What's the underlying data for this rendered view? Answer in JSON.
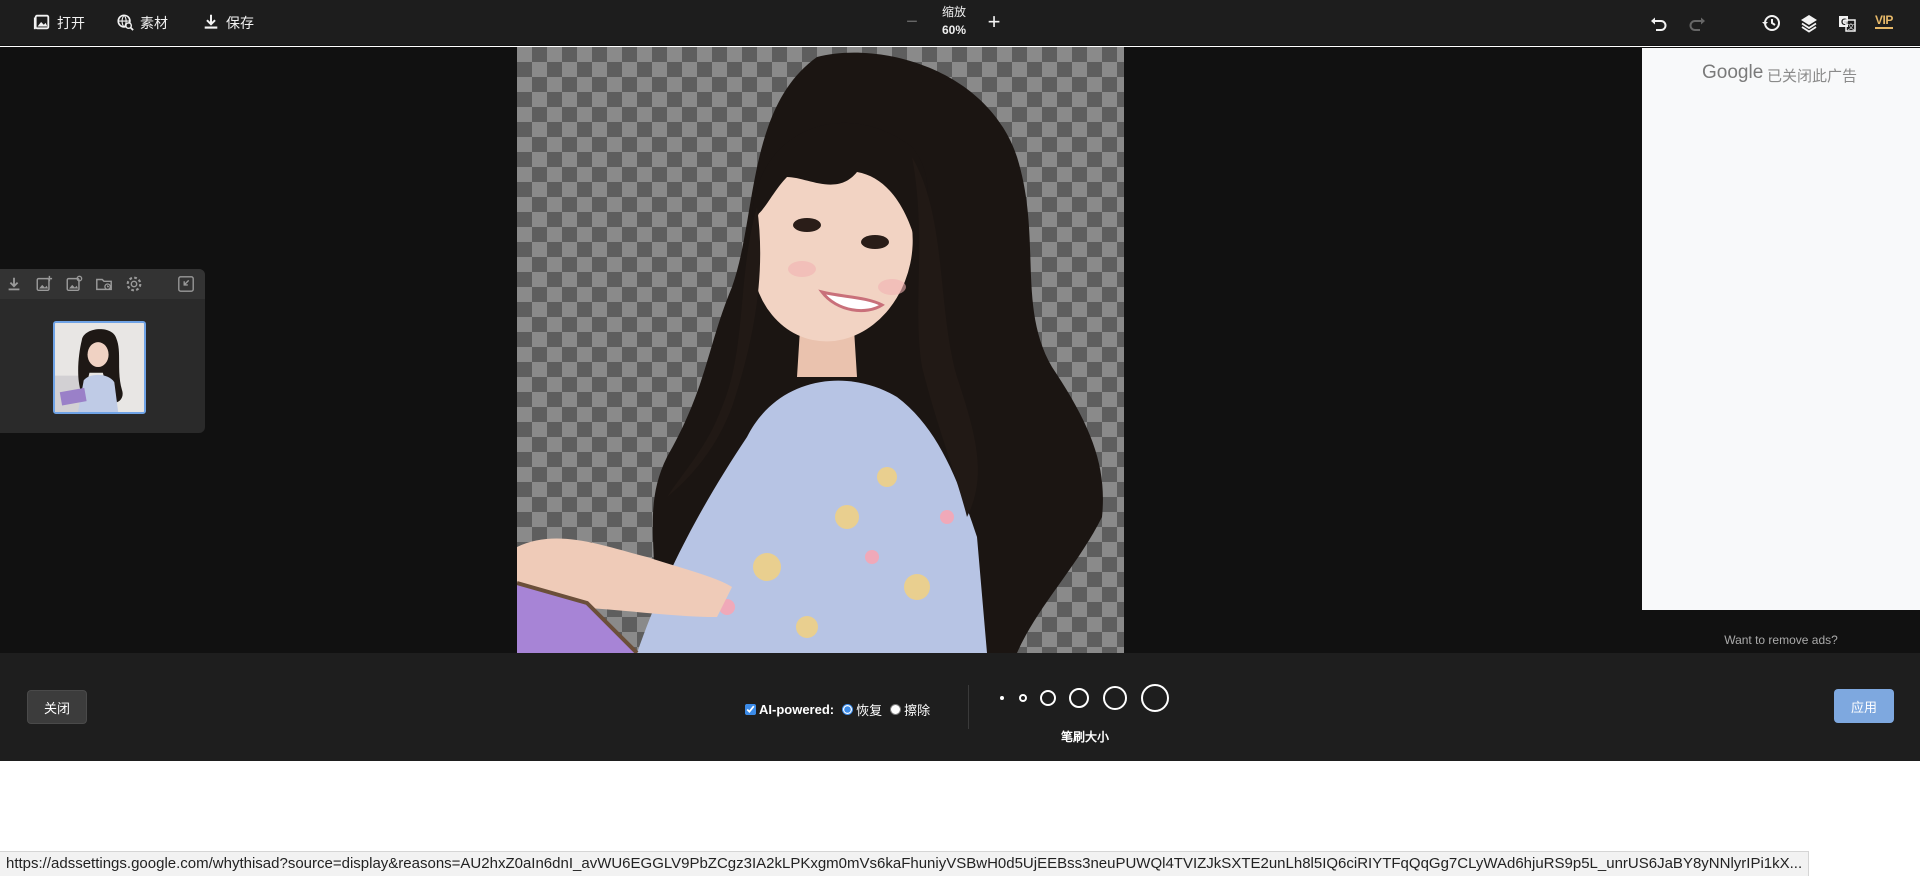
{
  "toolbar": {
    "open_label": "打开",
    "material_label": "素材",
    "save_label": "保存",
    "zoom_label": "缩放",
    "zoom_value": "60%",
    "zoom_minus": "−",
    "zoom_plus": "+",
    "vip_label": "VIP",
    "right_icons": [
      "undo-icon",
      "redo-icon",
      "history-icon",
      "layers-icon",
      "translate-icon",
      "vip-icon"
    ]
  },
  "file_panel": {
    "icons": [
      "download-icon",
      "add-image-icon",
      "image-settings-icon",
      "folder-icon",
      "gear-icon",
      "collapse-icon"
    ],
    "thumbnails": [
      {
        "selected": true
      }
    ]
  },
  "ad": {
    "brand": "Google",
    "closed_text": "已关闭此广告",
    "remove_ads": "Want to remove ads?"
  },
  "bottom": {
    "close_label": "关闭",
    "ai_label": "AI-powered:",
    "ai_checked": true,
    "restore_label": "恢复",
    "erase_label": "擦除",
    "selected_mode": "恢复",
    "brush_sizes": [
      1,
      2,
      3,
      4,
      5,
      6
    ],
    "brush_label": "笔刷大小",
    "apply_label": "应用"
  },
  "status_url": "https://adssettings.google.com/whythisad?source=display&reasons=AU2hxZ0aIn6dnI_avWU6EGGLV9PbZCgz3IA2kLPKxgm0mVs6kaFhuniyVSBwH0d5UjEEBss3neuPUWQl4TVIZJkSXTE2unLh8l5IQ6ciRIYTFqQqGg7CLyWAd6hjuRS9p5L_unrUS6JaBY8yNNlyrIPi1kX...",
  "colors": {
    "toolbar_bg": "#1d1d1d",
    "workspace_bg": "#111111",
    "accent_blue": "#7ea8df",
    "vip_gold": "#e7b969"
  }
}
